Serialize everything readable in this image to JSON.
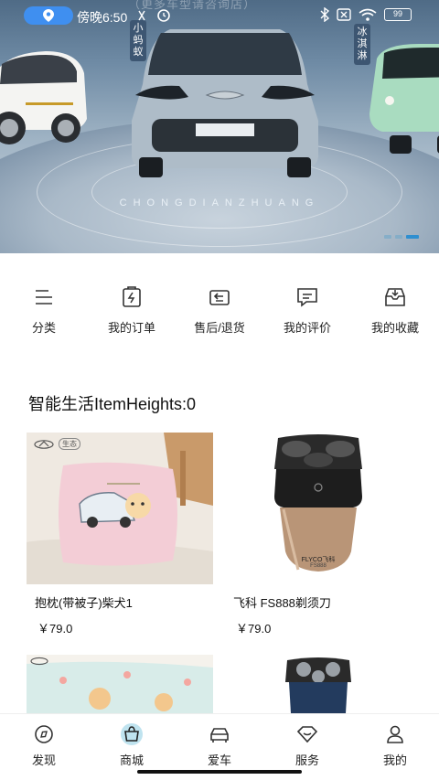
{
  "status_bar": {
    "time": "傍晚6:50",
    "battery": "99",
    "icons": [
      "location-icon",
      "alarm-icon",
      "bluetooth-icon",
      "sim-icon",
      "wifi-icon",
      "battery-icon"
    ]
  },
  "banner": {
    "top_text": "（更多车型请咨询店）",
    "tag_left": "小蚂蚁",
    "tag_right": "冰淇淋",
    "slogan": "CHONGDIANZHUANG",
    "active_dot": 2
  },
  "menu": {
    "items": [
      {
        "label": "分类",
        "icon": "category-icon"
      },
      {
        "label": "我的订单",
        "icon": "order-icon"
      },
      {
        "label": "售后/退货",
        "icon": "return-icon"
      },
      {
        "label": "我的评价",
        "icon": "review-icon"
      },
      {
        "label": "我的收藏",
        "icon": "favorite-icon"
      }
    ]
  },
  "section": {
    "title": "智能生活ItemHeights:0"
  },
  "products": [
    {
      "name": "抱枕(带被子)柴犬1",
      "price": "￥79.0"
    },
    {
      "name": "飞科 FS888剃须刀",
      "price": "￥79.0"
    },
    {
      "name": "",
      "price": ""
    },
    {
      "name": "",
      "price": ""
    }
  ],
  "product_brand": {
    "shaver_logo": "FLYCO飞科",
    "shaver_model": "FS888",
    "pillow_badge": "生态"
  },
  "bottom_nav": {
    "items": [
      {
        "label": "发现",
        "icon": "discover-icon"
      },
      {
        "label": "商城",
        "icon": "mall-icon",
        "active": true
      },
      {
        "label": "爱车",
        "icon": "car-icon"
      },
      {
        "label": "服务",
        "icon": "service-icon"
      },
      {
        "label": "我的",
        "icon": "profile-icon"
      }
    ]
  },
  "colors": {
    "accent": "#3f8ff0",
    "mall_active_bg": "#bfe3ef"
  }
}
